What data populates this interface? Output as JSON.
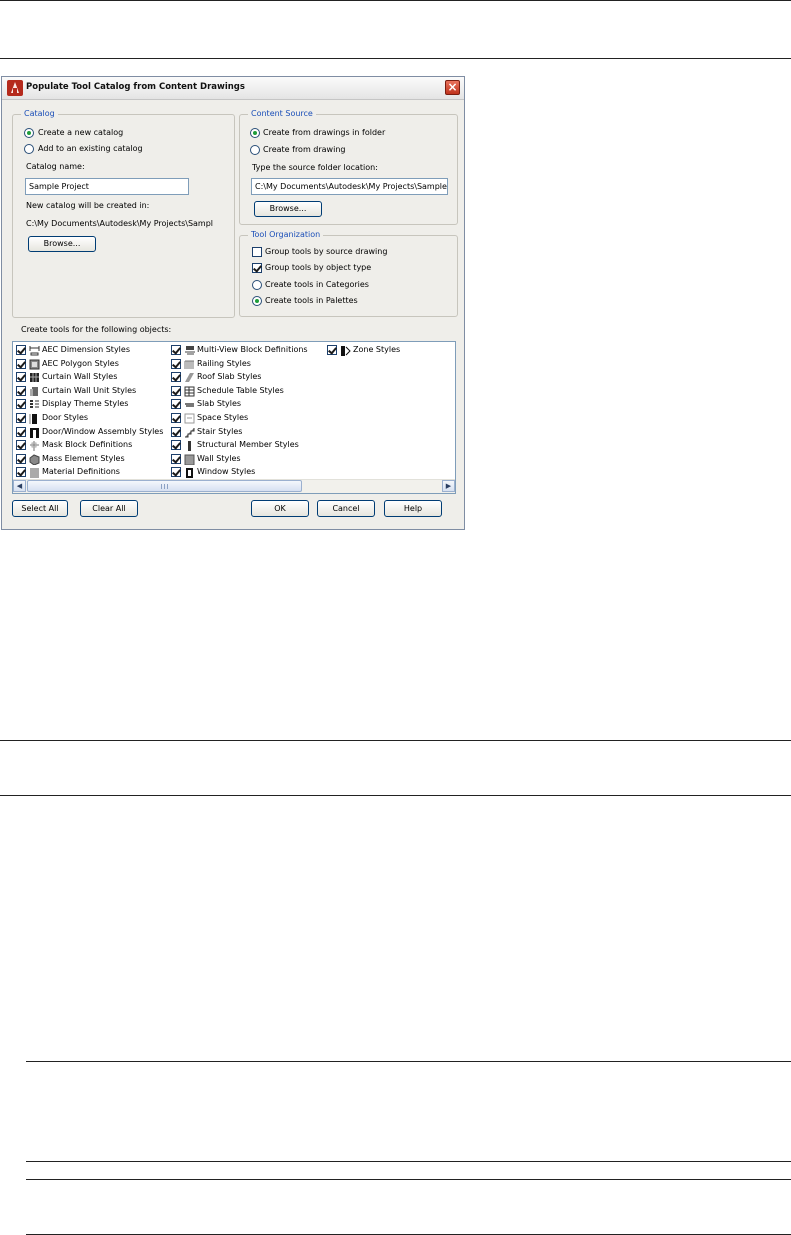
{
  "dialog": {
    "title": "Populate Tool Catalog from Content Drawings",
    "catalog": {
      "legend": "Catalog",
      "radio_new": "Create a new catalog",
      "radio_existing": "Add to an existing catalog",
      "name_label": "Catalog name:",
      "name_value": "Sample Project",
      "created_label": "New catalog will be created in:",
      "created_path": "C:\\My Documents\\Autodesk\\My Projects\\Sampl",
      "browse": "Browse..."
    },
    "source": {
      "legend": "Content Source",
      "radio_folder": "Create from drawings in folder",
      "radio_drawing": "Create from drawing",
      "folder_label": "Type the source folder location:",
      "folder_value": "C:\\My Documents\\Autodesk\\My Projects\\Sample I",
      "browse": "Browse..."
    },
    "organization": {
      "legend": "Tool Organization",
      "chk_group_source": "Group tools by source drawing",
      "chk_group_type": "Group tools by object type",
      "radio_categories": "Create tools in Categories",
      "radio_palettes": "Create tools in Palettes"
    },
    "objects_label": "Create tools for the following objects:",
    "objects": [
      {
        "label": "AEC Dimension Styles",
        "icon": "dimension-icon",
        "checked": true
      },
      {
        "label": "AEC Polygon Styles",
        "icon": "polygon-icon",
        "checked": true
      },
      {
        "label": "Curtain Wall Styles",
        "icon": "curtain-wall-icon",
        "checked": true
      },
      {
        "label": "Curtain Wall Unit Styles",
        "icon": "curtain-wall-unit-icon",
        "checked": true
      },
      {
        "label": "Display Theme Styles",
        "icon": "display-theme-icon",
        "checked": true
      },
      {
        "label": "Door Styles",
        "icon": "door-icon",
        "checked": true
      },
      {
        "label": "Door/Window Assembly Styles",
        "icon": "door-window-assembly-icon",
        "checked": true
      },
      {
        "label": "Mask Block Definitions",
        "icon": "mask-block-icon",
        "checked": true
      },
      {
        "label": "Mass Element Styles",
        "icon": "mass-element-icon",
        "checked": true
      },
      {
        "label": "Material Definitions",
        "icon": "material-icon",
        "checked": true
      },
      {
        "label": "Multi-View Block Definitions",
        "icon": "multi-view-block-icon",
        "checked": true
      },
      {
        "label": "Railing Styles",
        "icon": "railing-icon",
        "checked": true
      },
      {
        "label": "Roof Slab Styles",
        "icon": "roof-slab-icon",
        "checked": true
      },
      {
        "label": "Schedule Table Styles",
        "icon": "schedule-table-icon",
        "checked": true
      },
      {
        "label": "Slab Styles",
        "icon": "slab-icon",
        "checked": true
      },
      {
        "label": "Space Styles",
        "icon": "space-icon",
        "checked": true
      },
      {
        "label": "Stair Styles",
        "icon": "stair-icon",
        "checked": true
      },
      {
        "label": "Structural Member Styles",
        "icon": "structural-member-icon",
        "checked": true
      },
      {
        "label": "Wall Styles",
        "icon": "wall-icon",
        "checked": true
      },
      {
        "label": "Window Styles",
        "icon": "window-icon",
        "checked": true
      },
      {
        "label": "Zone Styles",
        "icon": "zone-icon",
        "checked": true
      }
    ],
    "buttons": {
      "select_all": "Select All",
      "clear_all": "Clear All",
      "ok": "OK",
      "cancel": "Cancel",
      "help": "Help"
    },
    "colors": {
      "legend_text": "#1b4fb8",
      "dialog_bg": "#efeeea",
      "radio_dot": "#1f9d3a",
      "close_button": "#c0331d"
    }
  }
}
